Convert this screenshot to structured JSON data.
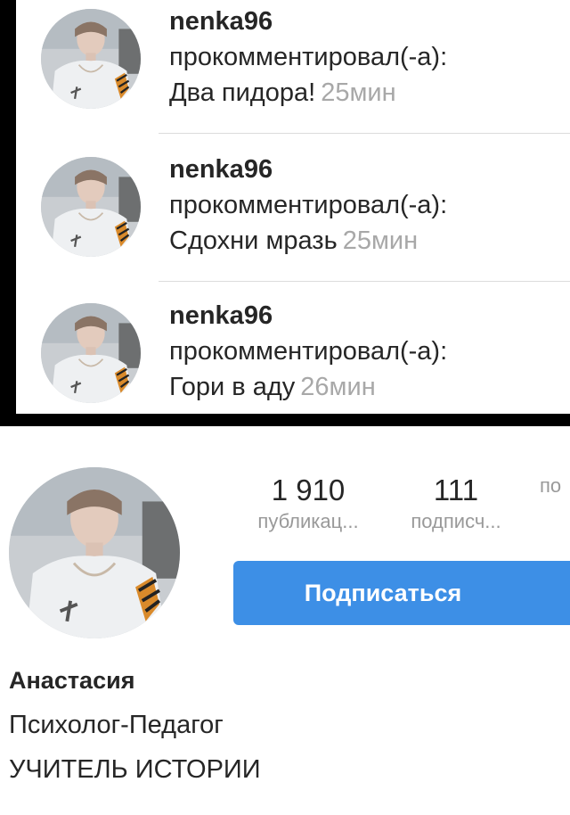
{
  "notifications": [
    {
      "username": "nenka96",
      "action": "прокомментировал(-а):",
      "comment": "Два пидора!",
      "time": "25мин"
    },
    {
      "username": "nenka96",
      "action": "прокомментировал(-а):",
      "comment": "Сдохни мразь",
      "time": "25мин"
    },
    {
      "username": "nenka96",
      "action": "прокомментировал(-а):",
      "comment": "Гори в аду",
      "time": "26мин"
    }
  ],
  "profile": {
    "stats": [
      {
        "value": "1 910",
        "label": "публикац..."
      },
      {
        "value": "111",
        "label": "подписч..."
      },
      {
        "value": "",
        "label": "по"
      }
    ],
    "subscribe_label": "Подписаться",
    "name": "Анастасия",
    "bio_line1": "Психолог-Педагог",
    "bio_line2": "УЧИТЕЛЬ ИСТОРИИ"
  },
  "colors": {
    "accent": "#3d8fe6",
    "time_text": "#a8a8a8",
    "frame": "#000000"
  }
}
